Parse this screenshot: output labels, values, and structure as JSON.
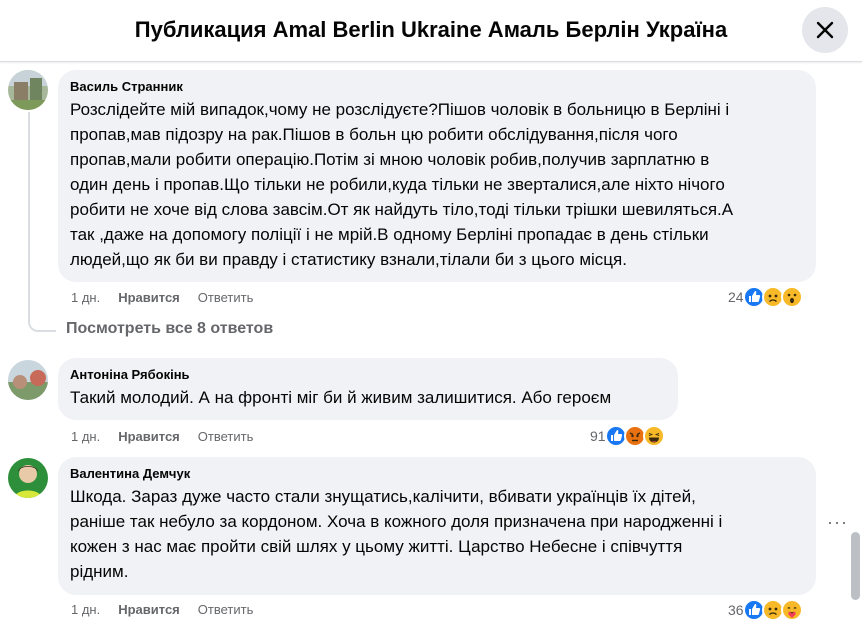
{
  "header": {
    "title": "Публикация Amal Berlin Ukraine Амаль Берлін Україна"
  },
  "comments": [
    {
      "author": "Василь Странник",
      "text": "Розслідейте мій випадок,чому не розслідуєте?Пішов чоловік в больницю в Берліні і\nпропав,мав підозру на рак.Пішов в больн цю робити обслідування,після чого\nпропав,мали робити операцію.Потім зі мною чоловік робив,получив зарплатню в\nодин день і пропав.Що тільки не робили,куда тільки не зверталися,але ніхто нічого\nробити не хоче від слова завсім.От як найдуть тіло,тоді тільки трішки шевиляться.А\nтак ,даже на допомогу поліції і не мрій.В одному Берліні пропадає в день стільки\nлюдей,що як би ви правду і статистику взнали,тілали би з цього місця.",
      "time": "1 дн.",
      "like_label": "Нравится",
      "reply_label": "Ответить",
      "reaction_count": "24"
    },
    {
      "author": "Антоніна Рябокінь",
      "text": "Такий молодий. А на фронті міг би й живим залишитися. Або героєм",
      "time": "1 дн.",
      "like_label": "Нравится",
      "reply_label": "Ответить",
      "reaction_count": "91"
    },
    {
      "author": "Валентина Демчук",
      "text": "Шкода. Зараз дуже часто стали знущатись,калічити, вбивати українців їх дітей,\nраніше так небуло за кордоном. Хоча в кожного доля призначена при народженні і\nкожен з нас має пройти свій шлях у цьому житті. Царство Небесне і співчуття\nрідним.",
      "time": "1 дн.",
      "like_label": "Нравится",
      "reply_label": "Ответить",
      "reaction_count": "36"
    }
  ],
  "view_replies": "Посмотреть все 8 ответов",
  "more_options": "···",
  "icons": {
    "close": "close-icon",
    "like": "like-reaction-icon",
    "sad": "sad-reaction-icon",
    "wow": "wow-reaction-icon",
    "angry": "angry-reaction-icon",
    "haha": "haha-reaction-icon",
    "care": "care-reaction-icon"
  },
  "colors": {
    "bubble": "#f0f2f5",
    "like_blue": "#1877f2",
    "emoji_yellow": "#f7b928",
    "angry_red": "#e9710f",
    "muted_text": "#65676b"
  }
}
